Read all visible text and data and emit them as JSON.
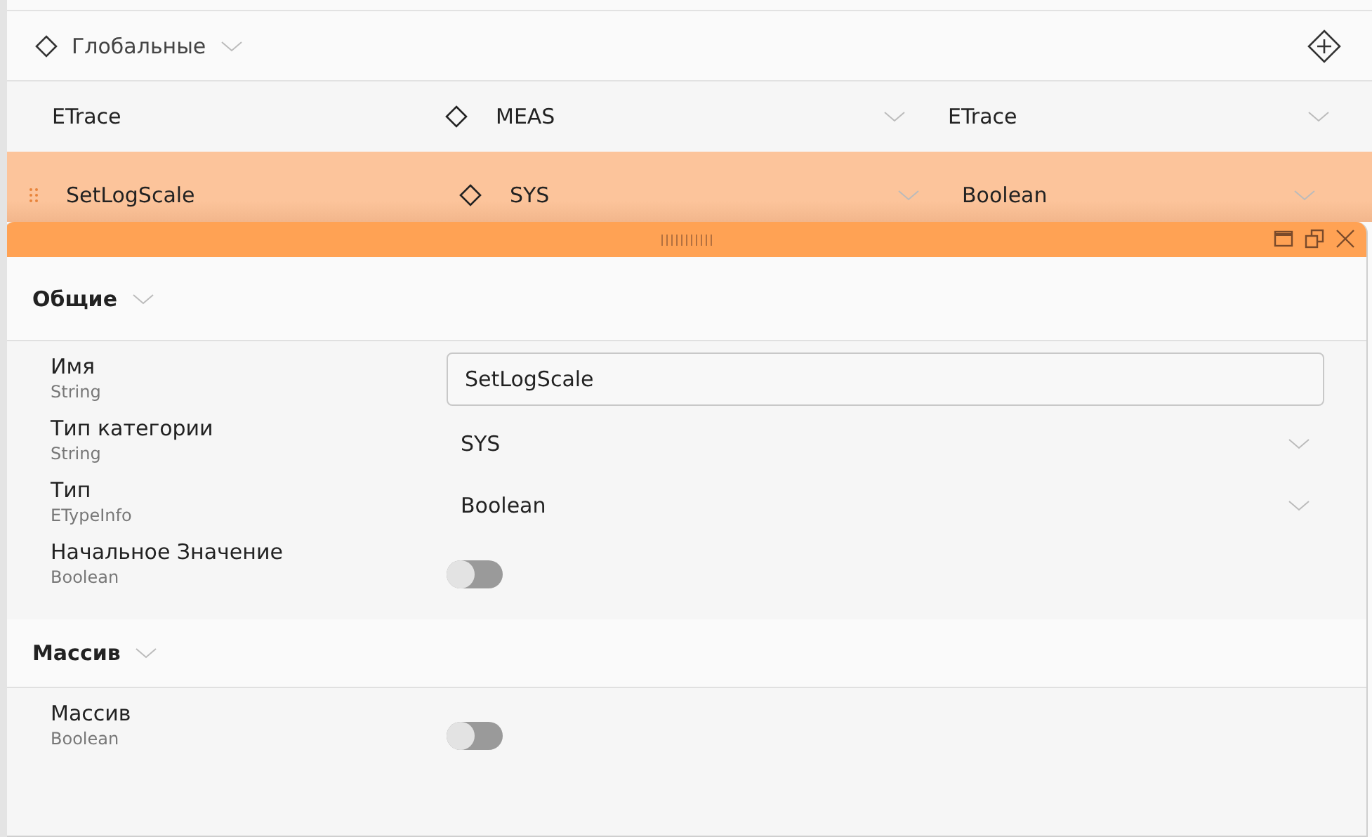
{
  "group": {
    "title": "Глобальные",
    "expanded": true
  },
  "rows": [
    {
      "name": "ETrace",
      "category": "MEAS",
      "type": "ETrace",
      "selected": false
    },
    {
      "name": "SetLogScale",
      "category": "SYS",
      "type": "Boolean",
      "selected": true
    }
  ],
  "panel": {
    "sections": [
      {
        "title": "Общие",
        "expanded": true,
        "properties": [
          {
            "label": "Имя",
            "type_hint": "String",
            "kind": "text",
            "value": "SetLogScale"
          },
          {
            "label": "Тип категории",
            "type_hint": "String",
            "kind": "select",
            "value": "SYS"
          },
          {
            "label": "Тип",
            "type_hint": "ETypeInfo",
            "kind": "select",
            "value": "Boolean"
          },
          {
            "label": "Начальное Значение",
            "type_hint": "Boolean",
            "kind": "toggle",
            "on": false
          }
        ]
      },
      {
        "title": "Массив",
        "expanded": true,
        "properties": [
          {
            "label": "Массив",
            "type_hint": "Boolean",
            "kind": "toggle",
            "on": false
          }
        ]
      }
    ]
  }
}
